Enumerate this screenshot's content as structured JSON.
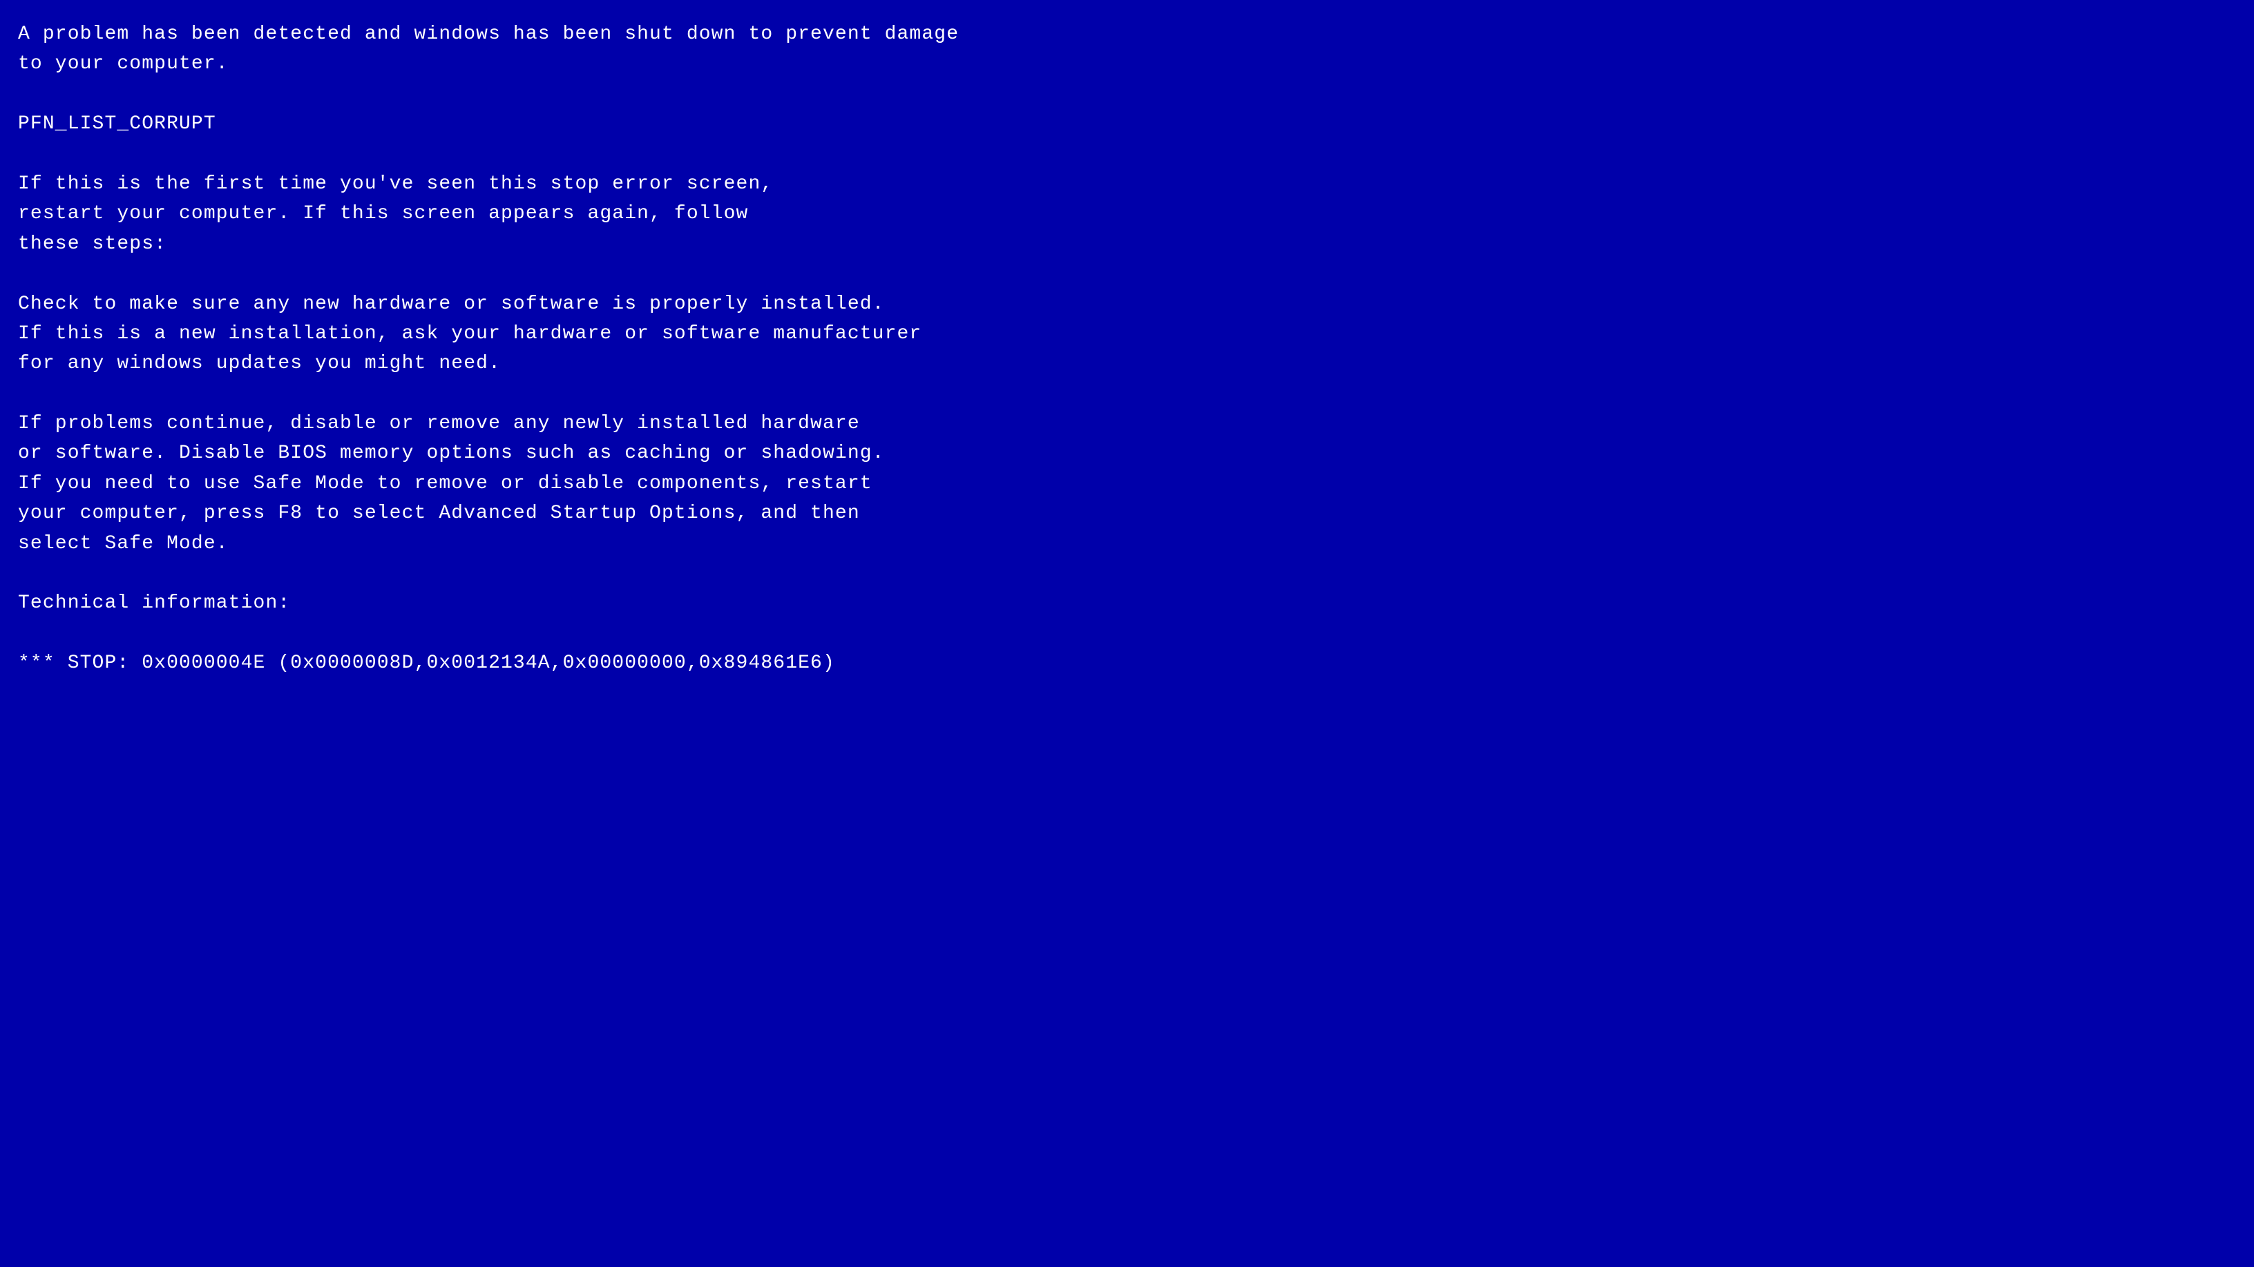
{
  "bsod": {
    "lines": [
      {
        "id": "line1",
        "text": "A problem has been detected and windows has been shut down to prevent damage"
      },
      {
        "id": "line2",
        "text": "to your computer."
      },
      {
        "id": "blank1",
        "text": ""
      },
      {
        "id": "error_code",
        "text": "PFN_LIST_CORRUPT"
      },
      {
        "id": "blank2",
        "text": ""
      },
      {
        "id": "line3",
        "text": "If this is the first time you've seen this stop error screen,"
      },
      {
        "id": "line4",
        "text": "restart your computer. If this screen appears again, follow"
      },
      {
        "id": "line5",
        "text": "these steps:"
      },
      {
        "id": "blank3",
        "text": ""
      },
      {
        "id": "line6",
        "text": "Check to make sure any new hardware or software is properly installed."
      },
      {
        "id": "line7",
        "text": "If this is a new installation, ask your hardware or software manufacturer"
      },
      {
        "id": "line8",
        "text": "for any windows updates you might need."
      },
      {
        "id": "blank4",
        "text": ""
      },
      {
        "id": "line9",
        "text": "If problems continue, disable or remove any newly installed hardware"
      },
      {
        "id": "line10",
        "text": "or software. Disable BIOS memory options such as caching or shadowing."
      },
      {
        "id": "line11",
        "text": "If you need to use Safe Mode to remove or disable components, restart"
      },
      {
        "id": "line12",
        "text": "your computer, press F8 to select Advanced Startup Options, and then"
      },
      {
        "id": "line13",
        "text": "select Safe Mode."
      },
      {
        "id": "blank5",
        "text": ""
      },
      {
        "id": "line14",
        "text": "Technical information:"
      },
      {
        "id": "blank6",
        "text": ""
      },
      {
        "id": "line15",
        "text": "*** STOP: 0x0000004E (0x0000008D,0x0012134A,0x00000000,0x894861E6)"
      }
    ]
  }
}
